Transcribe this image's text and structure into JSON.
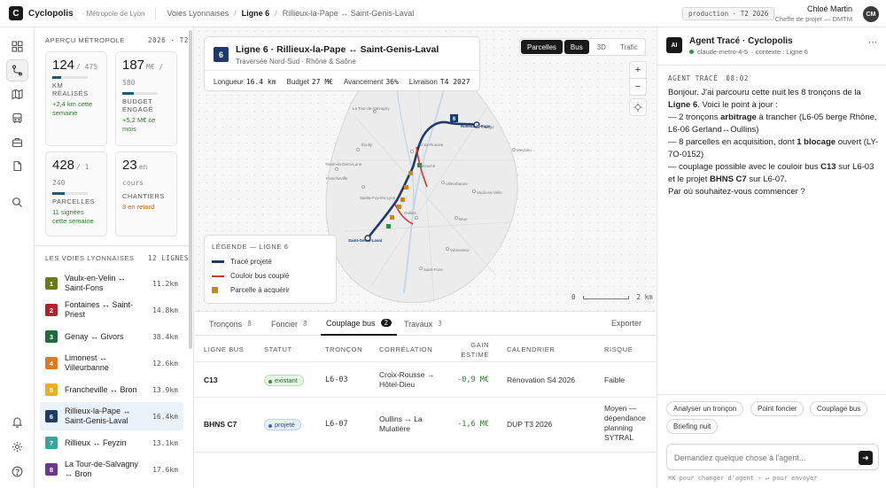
{
  "app": {
    "logo": "C",
    "name": "Cyclopolis",
    "region": "· Métropole de Lyon",
    "env": "production · T2 2026"
  },
  "breadcrumb": {
    "root": "Voies Lyonnaises",
    "line": "Ligne 6",
    "route": "Rillieux-la-Pape ↔ Saint-Genis-Laval"
  },
  "user": {
    "name": "Chloé Martin",
    "role": "Cheffe de projet — DMTM",
    "initials": "CM"
  },
  "rail": {
    "icons": [
      "dashboard-icon",
      "route-icon",
      "map-icon",
      "bus-icon",
      "toolbox-icon",
      "document-icon",
      "search-icon",
      "bell-icon",
      "settings-icon",
      "help-icon"
    ]
  },
  "overview": {
    "title": "APERÇU MÉTROPOLE",
    "period": "2026 · T2",
    "cards": [
      {
        "value": "124",
        "of": "/ 475",
        "unit": "km",
        "label": "KM RÉALISÉS",
        "note": "+2,4 km cette semaine",
        "note_color": "#2f7a2f",
        "progress": 0.26
      },
      {
        "value": "187",
        "of": "M€ / 580",
        "label": "BUDGET ENGAGÉ",
        "note": "+5,2 M€ ce mois",
        "note_color": "#2f7a2f",
        "progress": 0.32
      },
      {
        "value": "428",
        "of": "/ 1 240",
        "label": "PARCELLES",
        "note": "11 signées cette semaine",
        "note_color": "#2f7a2f",
        "progress": 0.35
      },
      {
        "value": "23",
        "of": "en cours",
        "label": "CHANTIERS",
        "note": "3 en retard",
        "note_color": "#c26a12",
        "progress": null
      }
    ]
  },
  "lines": {
    "title": "LES VOIES LYONNAISES",
    "count": "12 LIGNES",
    "items": [
      {
        "num": "1",
        "name": "Vaulx-en-Velin ↔ Saint-Fons",
        "km": "11.2km",
        "color": "#6b7a1f"
      },
      {
        "num": "2",
        "name": "Fontaines ↔ Saint-Priest",
        "km": "14.8km",
        "color": "#b3222a"
      },
      {
        "num": "3",
        "name": "Genay ↔ Givors",
        "km": "38.4km",
        "color": "#1f6b3a"
      },
      {
        "num": "4",
        "name": "Limonest ↔ Villeurbanne",
        "km": "12.6km",
        "color": "#e0781f"
      },
      {
        "num": "5",
        "name": "Francheville ↔ Bron",
        "km": "13.9km",
        "color": "#e8b21f"
      },
      {
        "num": "6",
        "name": "Rillieux-la-Pape ↔ Saint-Genis-Laval",
        "km": "16.4km",
        "color": "#1e3a6b"
      },
      {
        "num": "7",
        "name": "Rillieux ↔ Feyzin",
        "km": "13.1km",
        "color": "#3aa39a"
      },
      {
        "num": "8",
        "name": "La Tour-de-Salvagny ↔ Bron",
        "km": "17.6km",
        "color": "#6a3a8a"
      }
    ]
  },
  "map": {
    "line_num": "6",
    "title": "Ligne 6 · Rillieux-la-Pape ↔ Saint-Genis-Laval",
    "subtitle": "Traversée Nord-Sud · Rhône & Saône",
    "metrics": {
      "length_label": "Longueur",
      "length": "16.4 km",
      "budget_label": "Budget",
      "budget": "27 M€",
      "progress_label": "Avancement",
      "progress": "36%",
      "delivery_label": "Livraison",
      "delivery": "T4 2027"
    },
    "layers": [
      "Parcelles",
      "Bus",
      "3D",
      "Trafic"
    ],
    "zoom_in": "+",
    "zoom_out": "−",
    "legend": {
      "title": "LÉGENDE — LIGNE 6",
      "projected": "Tracé projeté",
      "bus": "Couloir bus couplé",
      "parcel": "Parcelle à acquérir"
    },
    "scale": {
      "start": "0",
      "end": "2 km"
    },
    "labels": {
      "rillieux": "Rillieux-la-Pape",
      "saint_genis": "Saint-Genis-Laval",
      "line_badge": "6",
      "croix_rousse": "Croix-Rousse",
      "perrache": "Perrache",
      "oullins": "Oullins",
      "tour_salvagny": "La Tour-de-Salvagny",
      "jonage": "Jonage",
      "meyzieu": "Meyzieu",
      "ecully": "Écully",
      "tassin": "Tassin-la-Demi-Lune",
      "francheville": "Francheville",
      "ste_foy": "Sainte-Foy-lès-Lyon",
      "la_mulatiere": "La Mulatière",
      "bron": "Bron",
      "venissieux": "Vénissieux",
      "saint_priest": "Saint-Priest",
      "saint_fons": "Saint-Fons",
      "villeurbanne": "Villeurbanne",
      "vaulx": "Vaulx-en-Velin",
      "caluire": "Caluire",
      "l6_codes": [
        "L6-01",
        "L6-02",
        "L6-03",
        "L6-05",
        "L6-06",
        "L6-07"
      ]
    }
  },
  "bottom": {
    "tabs": [
      {
        "label": "Tronçons",
        "count": "8"
      },
      {
        "label": "Foncier",
        "count": "8"
      },
      {
        "label": "Couplage bus",
        "count": "2"
      },
      {
        "label": "Travaux",
        "count": "3"
      }
    ],
    "export": "Exporter",
    "headers": [
      "LIGNE BUS",
      "STATUT",
      "TRONÇON",
      "CORRÉLATION",
      "GAIN ESTIMÉ",
      "CALENDRIER",
      "RISQUE"
    ],
    "rows": [
      {
        "line": "C13",
        "status": "existant",
        "segment": "L6-03",
        "correlation": "Croix-Rousse → Hôtel-Dieu",
        "gain": "-0,9 M€",
        "calendar": "Rénovation S4 2026",
        "risk": "Faible"
      },
      {
        "line": "BHNS C7",
        "status": "projeté",
        "segment": "L6-07",
        "correlation": "Oullins → La Mulatière",
        "gain": "-1,6 M€",
        "calendar": "DUP T3 2026",
        "risk": "Moyen — dépendance planning SYTRAL"
      }
    ]
  },
  "agent": {
    "logo": "AI",
    "title": "Agent Tracé · Cyclopolis",
    "model": "claude-metro-4-5",
    "context": "· contexte : Ligne 6",
    "author": "AGENT TRACÉ",
    "time": "08:02",
    "msg": {
      "p1a": "Bonjour. J'ai parcouru cette nuit les 8 tronçons de la ",
      "p1b": "Ligne 6",
      "p1c": ". Voici le point à jour :",
      "p2a": "— 2 tronçons ",
      "p2b": "arbitrage",
      "p2c": " à trancher (L6-05 berge Rhône, L6-06 Gerland↔Oullins)",
      "p3a": "— 8 parcelles en acquisition, dont ",
      "p3b": "1 blocage",
      "p3c": " ouvert (LY-7O-0152)",
      "p4a": "— couplage possible avec le couloir bus ",
      "p4b": "C13",
      "p4c": " sur L6-03 et le projet ",
      "p4d": "BHNS C7",
      "p4e": " sur L6-07.",
      "p5": "Par où souhaitez-vous commencer ?"
    },
    "suggestions": [
      "Analyser un tronçon",
      "Point foncier",
      "Couplage bus",
      "Briefing nuit"
    ],
    "input_placeholder": "Demandez quelque chose à l'agent...",
    "hint": "⌘K pour changer d'agent · ↵ pour envoyer"
  }
}
